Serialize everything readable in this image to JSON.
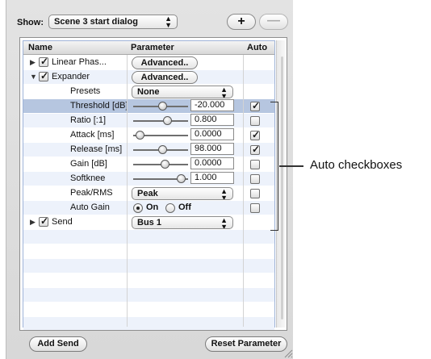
{
  "toolbar": {
    "show_label": "Show:",
    "show_value": "Scene 3 start dialog",
    "add_icon": "plus-icon",
    "add_symbol": "+",
    "remove_icon": "minus-icon",
    "remove_symbol": "—"
  },
  "table": {
    "columns": [
      "Name",
      "Parameter",
      "Auto"
    ],
    "rows": {
      "linear_phase": {
        "name": "Linear Phas...",
        "expanded": false,
        "checked": true,
        "button": "Advanced.."
      },
      "expander": {
        "name": "Expander",
        "expanded": true,
        "checked": true,
        "button": "Advanced.."
      },
      "presets": {
        "name": "Presets",
        "value": "None"
      },
      "threshold": {
        "name": "Threshold [dB]",
        "value": "-20.000",
        "auto": true,
        "level": 0.55
      },
      "ratio": {
        "name": "Ratio [:1]",
        "value": "0.800",
        "auto": false,
        "level": 0.65
      },
      "attack": {
        "name": "Attack [ms]",
        "value": "0.0000",
        "auto": true,
        "level": 0.05
      },
      "release": {
        "name": "Release [ms]",
        "value": "98.000",
        "auto": true,
        "level": 0.55
      },
      "gain": {
        "name": "Gain [dB]",
        "value": "0.0000",
        "auto": false,
        "level": 0.6
      },
      "softknee": {
        "name": "Softknee",
        "value": "1.000",
        "auto": false,
        "level": 0.95
      },
      "peak_rms": {
        "name": "Peak/RMS",
        "value": "Peak",
        "auto": false
      },
      "auto_gain": {
        "name": "Auto Gain",
        "on_label": "On",
        "off_label": "Off",
        "selected": "On",
        "auto": false
      },
      "send": {
        "name": "Send",
        "expanded": false,
        "checked": true,
        "value": "Bus 1"
      }
    }
  },
  "footer": {
    "add_send": "Add Send",
    "reset_parameter": "Reset Parameter"
  },
  "annotation": {
    "callout": "Auto checkboxes"
  }
}
